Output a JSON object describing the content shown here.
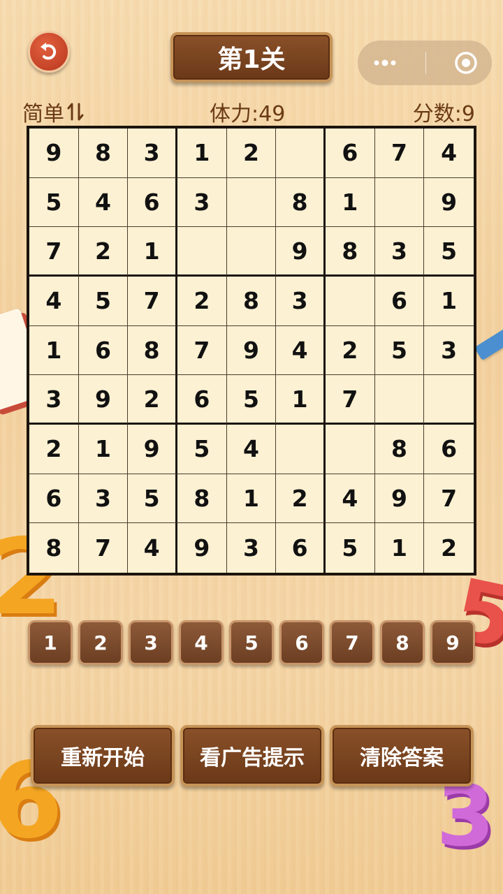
{
  "header": {
    "title": "第1关",
    "back_icon": "undo-arrow-icon",
    "more_icon": "more-dots-icon",
    "close_icon": "target-circle-icon"
  },
  "status": {
    "difficulty": "简单",
    "sort_icon": "up-down-arrows-icon",
    "stamina": "体力:49",
    "score": "分数:9"
  },
  "board": [
    [
      "9",
      "8",
      "3",
      "1",
      "2",
      "",
      "6",
      "7",
      "4"
    ],
    [
      "5",
      "4",
      "6",
      "3",
      "",
      "8",
      "1",
      "",
      "9"
    ],
    [
      "7",
      "2",
      "1",
      "",
      "",
      "9",
      "8",
      "3",
      "5"
    ],
    [
      "4",
      "5",
      "7",
      "2",
      "8",
      "3",
      "",
      "6",
      "1"
    ],
    [
      "1",
      "6",
      "8",
      "7",
      "9",
      "4",
      "2",
      "5",
      "3"
    ],
    [
      "3",
      "9",
      "2",
      "6",
      "5",
      "1",
      "7",
      "",
      ""
    ],
    [
      "2",
      "1",
      "9",
      "5",
      "4",
      "",
      "",
      "8",
      "6"
    ],
    [
      "6",
      "3",
      "5",
      "8",
      "1",
      "2",
      "4",
      "9",
      "7"
    ],
    [
      "8",
      "7",
      "4",
      "9",
      "3",
      "6",
      "5",
      "1",
      "2"
    ]
  ],
  "numpad": [
    "1",
    "2",
    "3",
    "4",
    "5",
    "6",
    "7",
    "8",
    "9"
  ],
  "actions": {
    "restart": "重新开始",
    "hint": "看广告提示",
    "clear": "清除答案"
  },
  "decorations": [
    "2",
    "5",
    "6",
    "3"
  ],
  "colors": {
    "background": "#f3d19f",
    "button_brown": "#6a3818",
    "button_border": "#c79458",
    "board_bg": "#fdf1d3",
    "back_button_red": "#c8401f"
  }
}
